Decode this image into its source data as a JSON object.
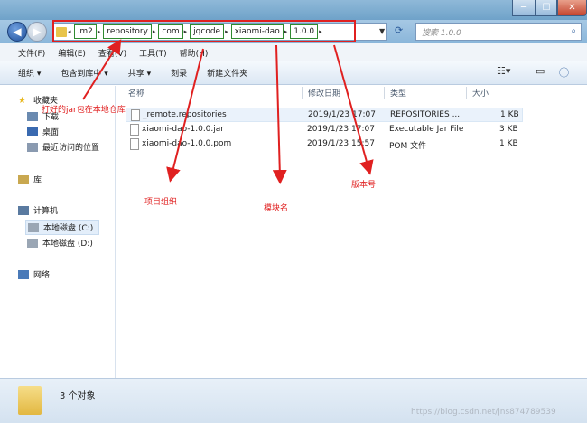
{
  "address": {
    "crumbs": [
      ".m2",
      "repository",
      "com",
      "jqcode",
      "xiaomi-dao",
      "1.0.0"
    ],
    "search_placeholder": "搜索 1.0.0"
  },
  "menu": [
    "文件(F)",
    "编辑(E)",
    "查看(V)",
    "工具(T)",
    "帮助(H)"
  ],
  "toolbar": [
    "组织 ▾",
    "包含到库中 ▾",
    "共享 ▾",
    "刻录",
    "新建文件夹"
  ],
  "sidebar": {
    "favorites": "收藏夹",
    "downloads": "下载",
    "desktop": "桌面",
    "recent": "最近访问的位置",
    "library": "库",
    "computer": "计算机",
    "drive_c": "本地磁盘 (C:)",
    "drive_d": "本地磁盘 (D:)",
    "network": "网络"
  },
  "columns": {
    "name": "名称",
    "date": "修改日期",
    "type": "类型",
    "size": "大小"
  },
  "files": [
    {
      "name": "_remote.repositories",
      "date": "2019/1/23 17:07",
      "type": "REPOSITORIES ...",
      "size": "1 KB"
    },
    {
      "name": "xiaomi-dao-1.0.0.jar",
      "date": "2019/1/23 17:07",
      "type": "Executable Jar File",
      "size": "3 KB"
    },
    {
      "name": "xiaomi-dao-1.0.0.pom",
      "date": "2019/1/23 15:57",
      "type": "POM 文件",
      "size": "1 KB"
    }
  ],
  "status": {
    "count": "3 个对象"
  },
  "watermark": "https://blog.csdn.net/jns874789539",
  "annotations": {
    "local_repo": "打好的jar包在本地仓库",
    "group": "项目组织",
    "module": "模块名",
    "version": "版本号"
  }
}
